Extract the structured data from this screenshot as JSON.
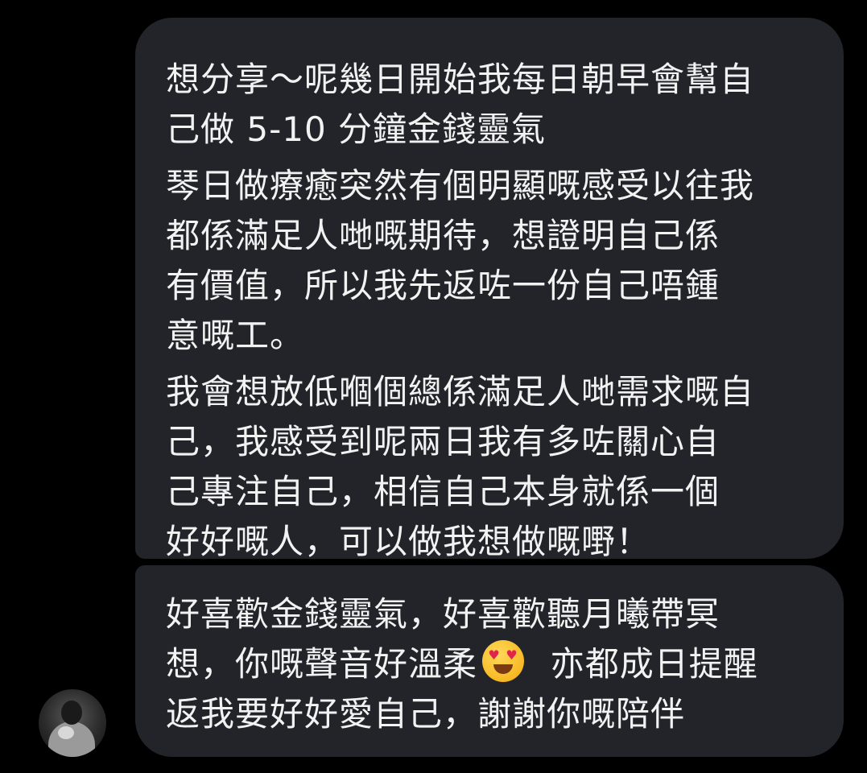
{
  "messages": [
    {
      "paragraphs": [
        [
          "想分享～呢幾日開始我每日朝早會幫自",
          "己做 5-10 分鐘金錢靈氣"
        ],
        [
          "琴日做療癒突然有個明顯嘅感受以往我",
          "都係滿足人哋嘅期待，想證明自己係",
          "有價值，所以我先返咗一份自己唔鍾",
          "意嘅工。"
        ],
        [
          "我會想放低嗰個總係滿足人哋需求嘅自",
          "己，我感受到呢兩日我有多咗關心自",
          "己專注自己，相信自己本身就係一個",
          "好好嘅人，可以做我想做嘅嘢！"
        ]
      ]
    },
    {
      "line1": "好喜歡金錢靈氣，好喜歡聽月曦帶冥",
      "line2_before": "想，你嘅聲音好溫柔",
      "emoji": "heart-eyes-emoji",
      "line2_after": "亦都成日提醒",
      "line3": "返我要好好愛自己，謝謝你嘅陪伴"
    }
  ],
  "colors": {
    "background": "#000000",
    "bubble": "#232429",
    "text": "#f2f2f2"
  }
}
